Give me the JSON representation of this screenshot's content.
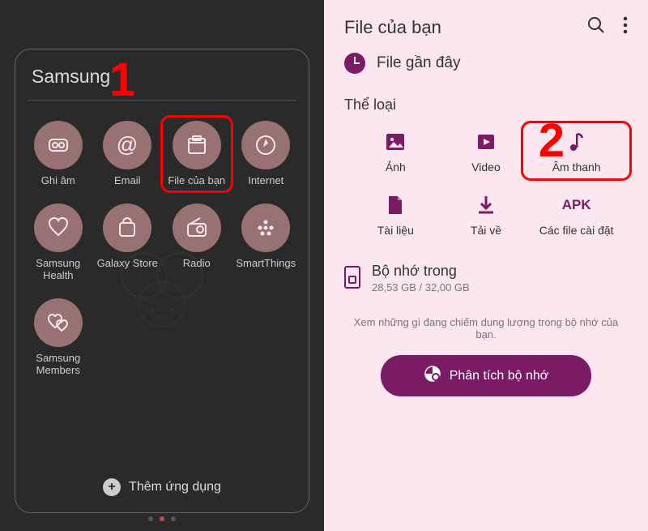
{
  "left": {
    "folder_title": "Samsung",
    "apps": [
      {
        "label": "Ghi âm",
        "name": "voice-recorder-app",
        "icon": "rec"
      },
      {
        "label": "Email",
        "name": "email-app",
        "icon": "at"
      },
      {
        "label": "File của bạn",
        "name": "my-files-app",
        "icon": "file",
        "highlight": true
      },
      {
        "label": "Internet",
        "name": "internet-app",
        "icon": "compass"
      },
      {
        "label": "Samsung Health",
        "name": "samsung-health-app",
        "icon": "heart"
      },
      {
        "label": "Galaxy Store",
        "name": "galaxy-store-app",
        "icon": "bag"
      },
      {
        "label": "Radio",
        "name": "radio-app",
        "icon": "radio"
      },
      {
        "label": "SmartThings",
        "name": "smartthings-app",
        "icon": "dots"
      },
      {
        "label": "Samsung Members",
        "name": "samsung-members-app",
        "icon": "hearts"
      }
    ],
    "add_apps": "Thêm ứng dụng",
    "step_number": "1"
  },
  "right": {
    "title": "File của bạn",
    "recent": "File gần đây",
    "categories_label": "Thể loại",
    "categories": [
      {
        "label": "Ảnh",
        "name": "images-category",
        "icon": "image"
      },
      {
        "label": "Video",
        "name": "videos-category",
        "icon": "video"
      },
      {
        "label": "Âm thanh",
        "name": "audio-category",
        "icon": "audio",
        "highlight": true
      },
      {
        "label": "Tài liệu",
        "name": "documents-category",
        "icon": "doc"
      },
      {
        "label": "Tải về",
        "name": "downloads-category",
        "icon": "download"
      },
      {
        "label": "Các file cài đặt",
        "name": "apk-category",
        "icon": "apk"
      }
    ],
    "storage": {
      "title": "Bộ nhớ trong",
      "sub": "28,53 GB / 32,00 GB"
    },
    "hint": "Xem những gì đang chiếm dung lượng trong bộ nhớ của bạn.",
    "analyze": "Phân tích bộ nhớ",
    "step_number": "2"
  }
}
